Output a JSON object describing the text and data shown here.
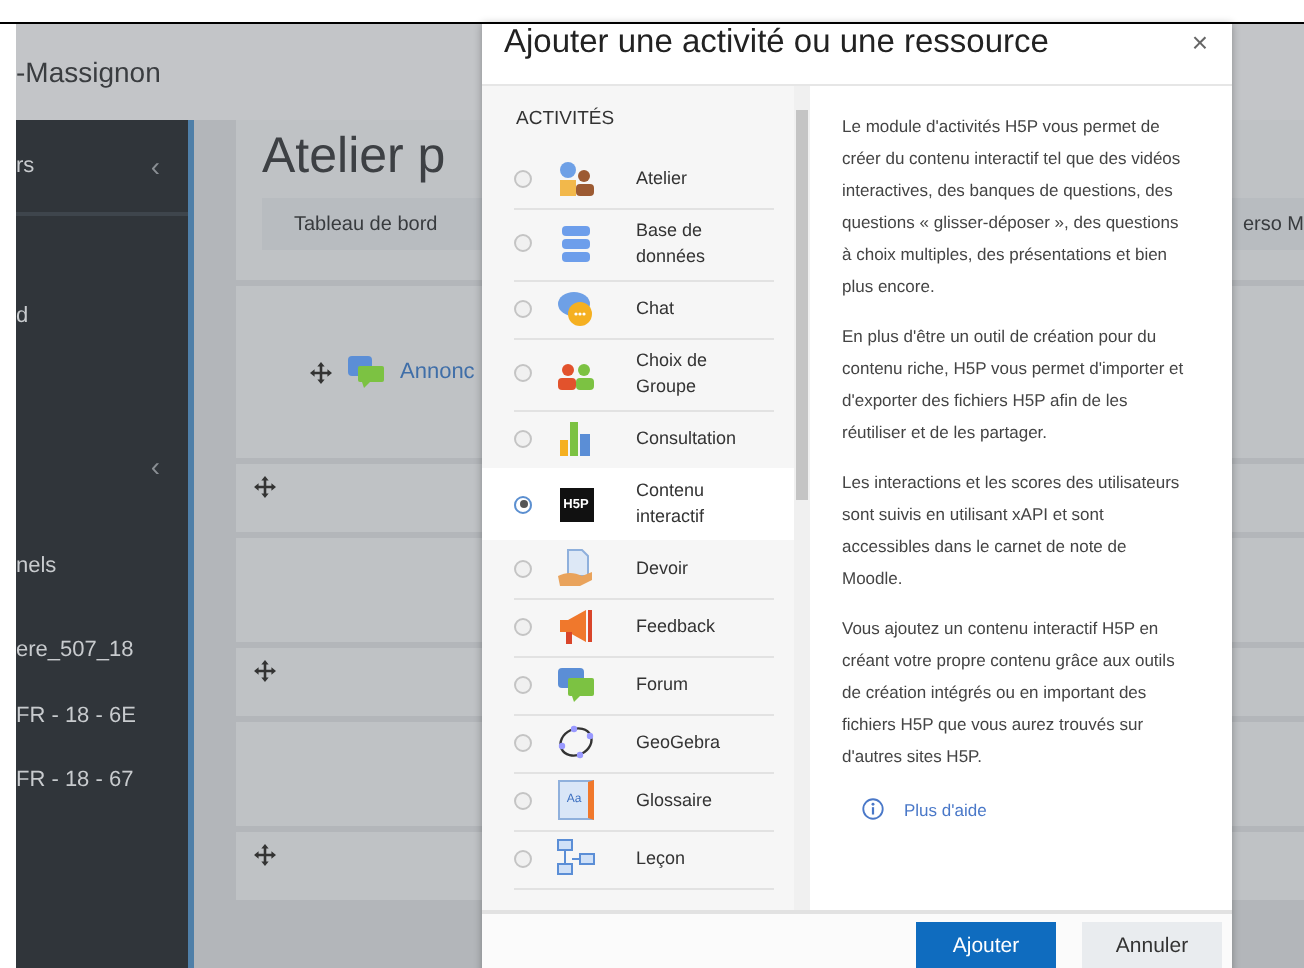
{
  "page": {
    "site_title": "-Massignon",
    "sidebar": {
      "items": [
        {
          "label": "rs",
          "chevron": "‹"
        },
        {
          "label": "d"
        },
        {
          "chevron": "‹"
        },
        {
          "label": "nels"
        },
        {
          "label": "ere_507_18"
        },
        {
          "label": "FR - 18 - 6E"
        },
        {
          "label": "FR - 18 - 67"
        }
      ]
    },
    "course_title": "Atelier p",
    "breadcrumb": [
      "Tableau de bord",
      "erso M"
    ],
    "announcement": "Annonc"
  },
  "dialog": {
    "title": "Ajouter une activité ou une ressource",
    "close": "×",
    "section": "ACTIVITÉS",
    "items": [
      {
        "kind": "workshop",
        "label": "Atelier",
        "selected": false
      },
      {
        "kind": "database",
        "label": "Base de données",
        "selected": false
      },
      {
        "kind": "chat",
        "label": "Chat",
        "selected": false
      },
      {
        "kind": "choice",
        "label": "Choix de Groupe",
        "selected": false
      },
      {
        "kind": "survey",
        "label": "Consultation",
        "selected": false
      },
      {
        "kind": "h5p",
        "label": "Contenu interactif",
        "logo_text": "H5P",
        "selected": true
      },
      {
        "kind": "assignment",
        "label": "Devoir",
        "selected": false
      },
      {
        "kind": "feedback",
        "label": "Feedback",
        "selected": false
      },
      {
        "kind": "forum",
        "label": "Forum",
        "selected": false
      },
      {
        "kind": "geogebra",
        "label": "GeoGebra",
        "selected": false
      },
      {
        "kind": "glossary",
        "label": "Glossaire",
        "logo_text": "Aa",
        "selected": false
      },
      {
        "kind": "lesson",
        "label": "Leçon",
        "selected": false
      }
    ],
    "help": [
      "Le module d'activités H5P vous permet de créer du contenu interactif tel que des vidéos interactives, des banques de questions, des questions « glisser-déposer », des questions à choix multiples, des présentations et bien plus encore.",
      "En plus d'être un outil de création pour du contenu riche, H5P vous permet d'importer et d'exporter des fichiers H5P afin de les réutiliser et de les partager.",
      "Les interactions et les scores des utilisateurs sont suivis en utilisant xAPI et sont accessibles dans le carnet de note de Moodle.",
      "Vous ajoutez un contenu interactif H5P en créant votre propre contenu grâce aux outils de création intégrés ou en important des fichiers H5P que vous aurez trouvés sur d'autres sites H5P."
    ],
    "help_link": "Plus d'aide",
    "buttons": [
      {
        "kind": "primary",
        "label": "Ajouter"
      },
      {
        "kind": "secondary",
        "label": "Annuler"
      }
    ]
  }
}
